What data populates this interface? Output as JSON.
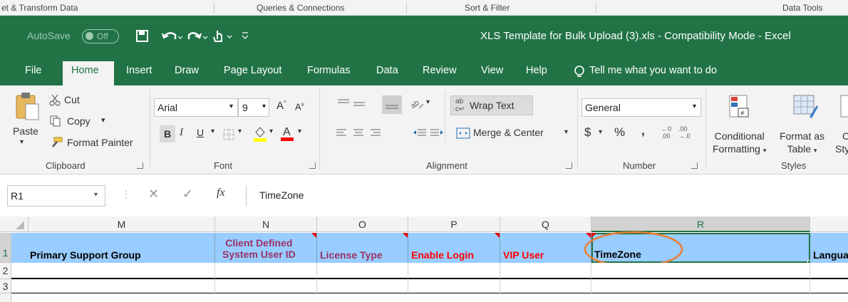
{
  "topstrip": {
    "group_a": "et & Transform Data",
    "group_b": "Queries & Connections",
    "group_c": "Sort & Filter",
    "group_d": "Data Tools"
  },
  "titlebar": {
    "autosave_label": "AutoSave",
    "autosave_state": "Off",
    "document_title": "XLS Template for Bulk Upload (3).xls  -  Compatibility Mode  -  Excel"
  },
  "tabs": {
    "file": "File",
    "home": "Home",
    "insert": "Insert",
    "draw": "Draw",
    "page_layout": "Page Layout",
    "formulas": "Formulas",
    "data": "Data",
    "review": "Review",
    "view": "View",
    "help": "Help",
    "tell_me": "Tell me what you want to do"
  },
  "ribbon": {
    "clipboard": {
      "paste": "Paste",
      "cut": "Cut",
      "copy": "Copy",
      "format_painter": "Format Painter",
      "label": "Clipboard"
    },
    "font": {
      "name": "Arial",
      "size": "9",
      "bold": "B",
      "italic": "I",
      "underline": "U",
      "label": "Font"
    },
    "alignment": {
      "wrap_text": "Wrap Text",
      "merge_center": "Merge & Center",
      "label": "Alignment"
    },
    "number": {
      "format": "General",
      "currency": "$",
      "percent": "%",
      "comma": ",",
      "label": "Number"
    },
    "styles": {
      "conditional_1": "Conditional",
      "conditional_2": "Formatting",
      "format_as_1": "Format as",
      "format_as_2": "Table",
      "cell_styles_1": "C",
      "cell_styles_2": "Sty",
      "label": "Styles"
    }
  },
  "formula_bar": {
    "name_box": "R1",
    "fx": "fx",
    "content": "TimeZone"
  },
  "grid": {
    "columns": [
      "M",
      "N",
      "O",
      "P",
      "Q",
      "R"
    ],
    "rows": [
      "1",
      "2",
      "3"
    ],
    "headers": {
      "m": "Primary Support Group",
      "n_line1": "Client Defined",
      "n_line2": "System User ID",
      "o": "License Type",
      "p": "Enable Login",
      "q": "VIP User",
      "r": "TimeZone",
      "s": "Langua"
    }
  },
  "colors": {
    "excel_green": "#217346",
    "header_fill": "#99ccff",
    "purple_text": "#993366",
    "red_text": "#ff0000",
    "annotation_orange": "#ed7d31"
  }
}
